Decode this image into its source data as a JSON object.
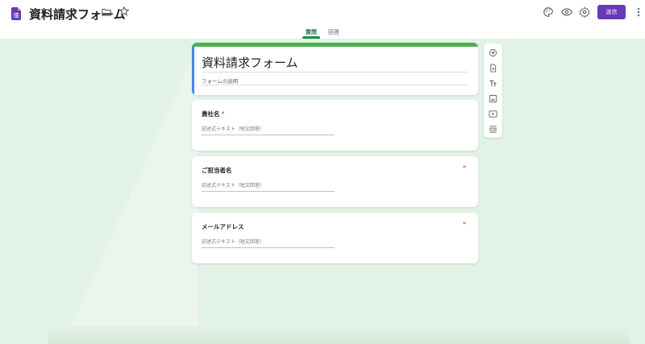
{
  "header": {
    "title": "資料請求フォーム",
    "send_label": "送信",
    "icons": [
      "forms-app-icon",
      "folder-icon",
      "star-icon",
      "palette-icon",
      "eye-icon",
      "settings-icon",
      "more-vert-icon"
    ]
  },
  "tabs": [
    {
      "label": "質問",
      "active": true
    },
    {
      "label": "回答",
      "active": false
    }
  ],
  "form": {
    "title": "資料請求フォーム",
    "description_placeholder": "フォームの説明"
  },
  "questions": [
    {
      "label": "貴社名",
      "required_mark": "*",
      "placeholder": "記述式テキスト（短文回答）"
    },
    {
      "label": "ご担当者名",
      "required_mark": "*",
      "placeholder": "記述式テキスト（短文回答）"
    },
    {
      "label": "メールアドレス",
      "required_mark": "*",
      "placeholder": "記述式テキスト（短文回答）"
    }
  ],
  "toolbar": {
    "icons": [
      "add-question-icon",
      "import-questions-icon",
      "add-title-icon",
      "add-image-icon",
      "add-video-icon",
      "add-section-icon"
    ]
  },
  "colors": {
    "accent": "#673ab7",
    "theme_green": "#4caf50",
    "active_tab": "#1e8e3e",
    "background": "#e3f2e6",
    "required": "#d93025"
  }
}
